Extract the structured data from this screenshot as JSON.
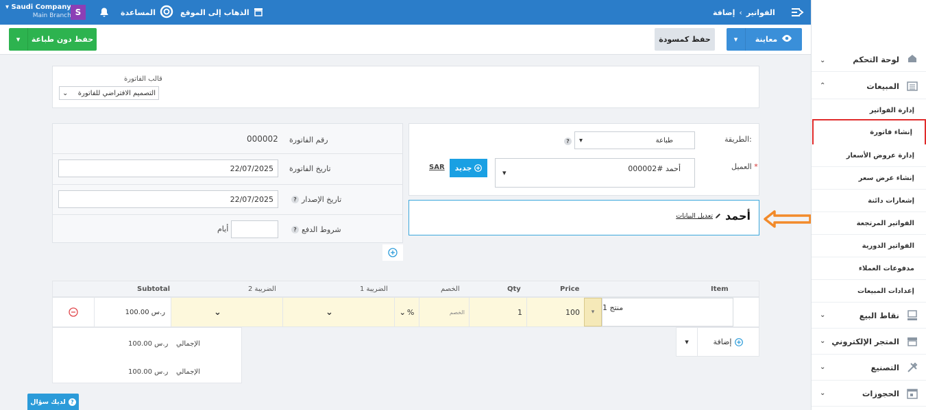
{
  "topbar": {
    "company": "Saudi Company",
    "branch": "Main Branch",
    "avatar": "S",
    "help": "المساعدة",
    "goto_site": "الذهاب إلى الموقع",
    "breadcrumb_parent": "الفواتير",
    "breadcrumb_current": "إضافة"
  },
  "toolbar": {
    "save_no_print": "حفظ دون طباعة",
    "save_draft": "حفظ كمسودة",
    "preview": "معاينة"
  },
  "template": {
    "label": "قالب الفاتورة",
    "value": "التصميم الافتراضي للفاتورة"
  },
  "invoice": {
    "number_label": "رقم الفاتورة",
    "number": "000002",
    "date_label": "تاريخ الفاتورة",
    "date": "22/07/2025",
    "issue_label": "تاريخ الإصدار",
    "issue_date": "22/07/2025",
    "terms_label": "شروط الدفع",
    "terms_unit": "أيام"
  },
  "client": {
    "method_label": "الطريقة:",
    "method_value": "طباعة",
    "client_label": "العميل",
    "client_value": "أحمد #000002",
    "new_btn": "جديد",
    "currency": "SAR",
    "name_display": "أحمد",
    "edit_link": "تعديل البيانات"
  },
  "items": {
    "headers": {
      "item": "Item",
      "price": "Price",
      "qty": "Qty",
      "discount": "الخصم",
      "tax1": "الضريبة 1",
      "tax2": "الضريبة 2",
      "subtotal": "Subtotal"
    },
    "row": {
      "name": "منتج 1",
      "price": "100",
      "qty": "1",
      "discount_placeholder": "الخصم",
      "discount_unit": "%",
      "subtotal": "100.00 ر.س"
    },
    "add_label": "إضافة",
    "totals": [
      {
        "label": "الإجمالي",
        "value": "100.00 ر.س"
      },
      {
        "label": "الإجمالي",
        "value": "100.00 ر.س"
      }
    ]
  },
  "help_btn": "لديك سؤال",
  "sidebar": {
    "main": [
      {
        "label": "لوحة التحكم",
        "icon": "home-icon"
      },
      {
        "label": "المبيعات",
        "icon": "list-icon"
      },
      {
        "label": "نقاط البيع",
        "icon": "pos-icon"
      },
      {
        "label": "المتجر الإلكتروني",
        "icon": "store-icon"
      },
      {
        "label": "التصنيع",
        "icon": "tools-icon"
      },
      {
        "label": "الحجوزات",
        "icon": "calendar-icon"
      }
    ],
    "sub": [
      "إدارة الفواتير",
      "إنشاء فاتورة",
      "إدارة عروض الأسعار",
      "إنشاء عرض سعر",
      "إشعارات دائنة",
      "الفواتير المرتجعة",
      "الفواتير الدورية",
      "مدفوعات العملاء",
      "إعدادات المبيعات"
    ]
  },
  "colors": {
    "topbar": "#2b7dc9",
    "green": "#2db34f",
    "blue": "#3a8fd9",
    "highlight": "#e02b2b",
    "arrow": "#f28a2a"
  }
}
